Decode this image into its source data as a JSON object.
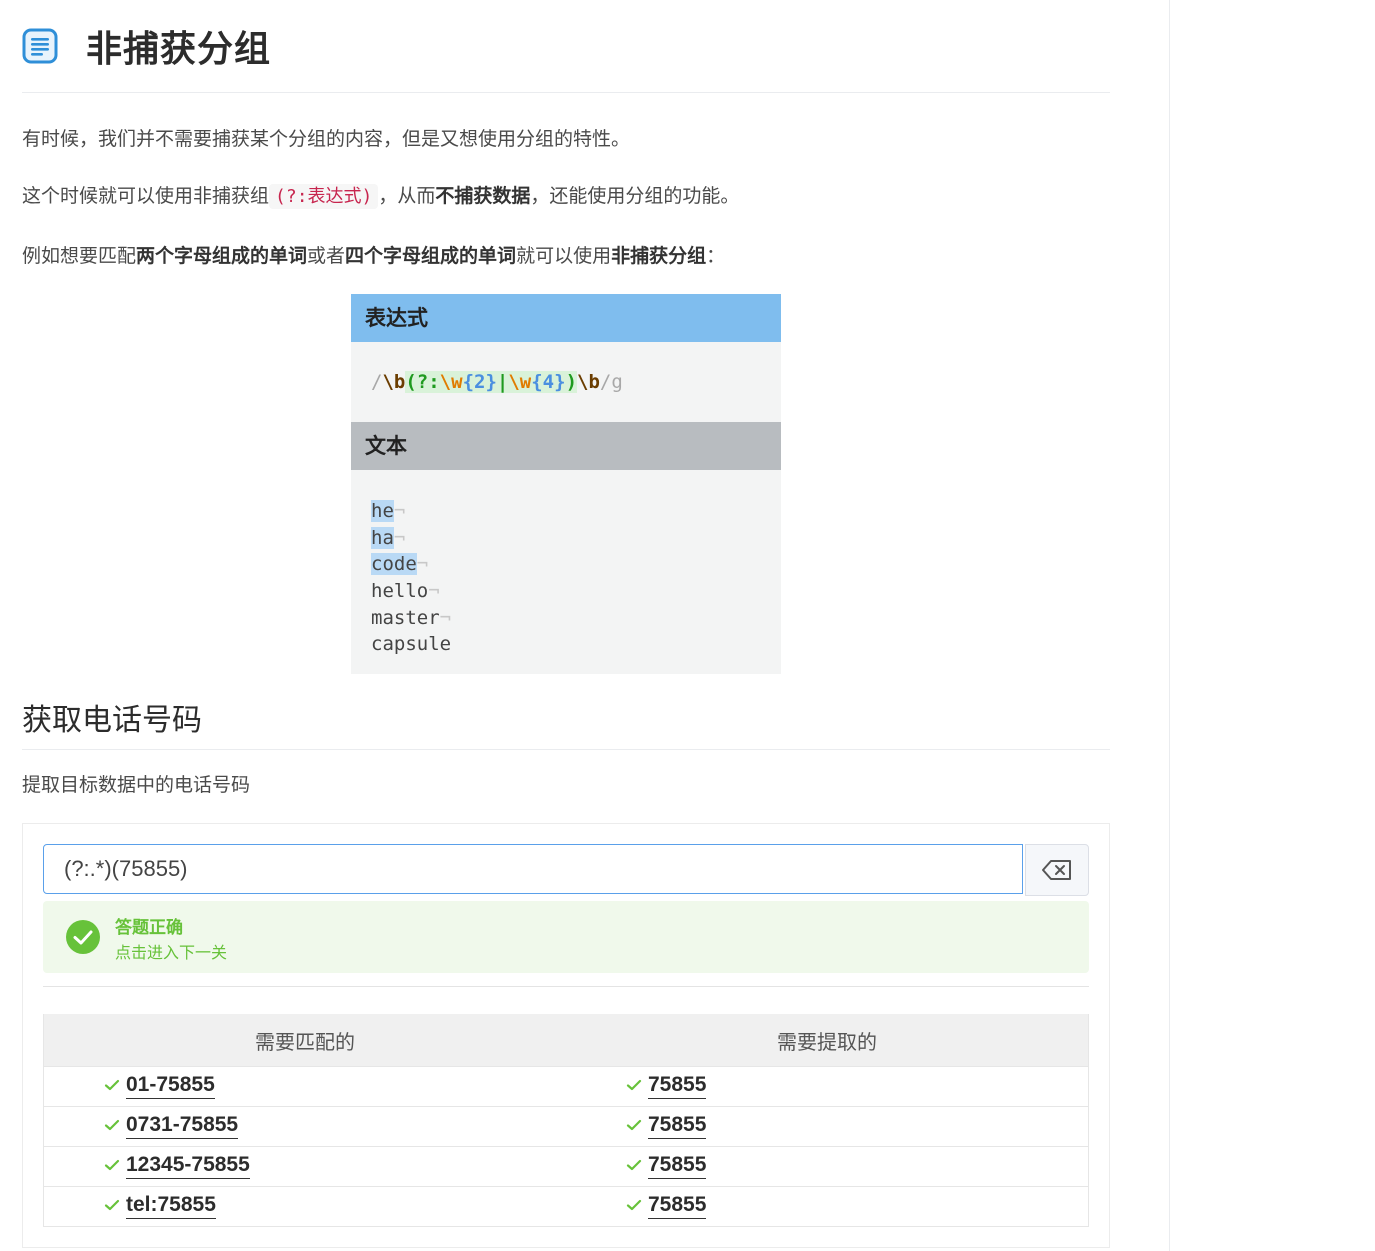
{
  "section1": {
    "title": "非捕获分组",
    "p1": "有时候，我们并不需要捕获某个分组的内容，但是又想使用分组的特性。",
    "p2_before": "这个时候就可以使用非捕获组",
    "p2_code": "(?:表达式)",
    "p2_mid": "，从而",
    "p2_bold": "不捕获数据",
    "p2_after": "，还能使用分组的功能。",
    "p3_a": "例如想要匹配",
    "p3_b": "两个字母组成的单词",
    "p3_c": "或者",
    "p3_d": "四个字母组成的单词",
    "p3_e": "就可以使用",
    "p3_f": "非捕获分组",
    "p3_g": "："
  },
  "illustration": {
    "expr_header": "表达式",
    "text_header": "文本",
    "regex_tokens": {
      "slash_open": "/",
      "b1": "\\b",
      "group_open": "(?:",
      "w1": "\\w",
      "q1": "{2}",
      "alt": "|",
      "w2": "\\w",
      "q2": "{4}",
      "group_close": ")",
      "b2": "\\b",
      "slash_close": "/",
      "flag": "g"
    },
    "lines": [
      {
        "text": "he",
        "match": true
      },
      {
        "text": "ha",
        "match": true
      },
      {
        "text": "code",
        "match": true
      },
      {
        "text": "hello",
        "match": false
      },
      {
        "text": "master",
        "match": false
      },
      {
        "text": "capsule",
        "match": false
      }
    ],
    "newline_symbol": "¬"
  },
  "section2": {
    "title": "获取电话号码",
    "desc": "提取目标数据中的电话号码"
  },
  "exercise": {
    "input_value": "(?:.*)(75855)",
    "result_title": "答题正确",
    "result_link": "点击进入下一关",
    "col_match": "需要匹配的",
    "col_extract": "需要提取的",
    "rows": [
      {
        "match": "01-75855",
        "extract": "75855"
      },
      {
        "match": "0731-75855",
        "extract": "75855"
      },
      {
        "match": "12345-75855",
        "extract": "75855"
      },
      {
        "match": "tel:75855",
        "extract": "75855"
      }
    ],
    "colors": {
      "success": "#67c23a",
      "accent": "#409eff"
    }
  },
  "icons": {
    "heading": "document-icon",
    "clear": "backspace-icon",
    "result": "check-circle-icon",
    "row": "check-icon"
  }
}
